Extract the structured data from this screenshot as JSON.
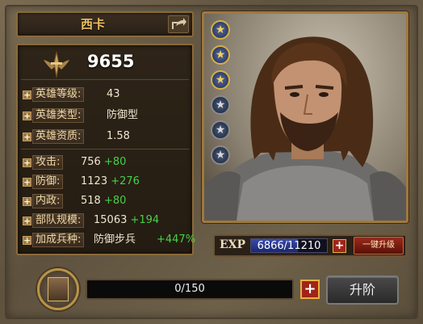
{
  "hero": {
    "name": "西卡",
    "power": "9655"
  },
  "stats": {
    "level": {
      "label": "英雄等级:",
      "value": "43"
    },
    "type": {
      "label": "英雄类型:",
      "value": "防御型"
    },
    "aptitude": {
      "label": "英雄资质:",
      "value": "1.58"
    },
    "attack": {
      "label": "攻击:",
      "value": "756",
      "bonus": "+80"
    },
    "defense": {
      "label": "防御:",
      "value": "1123",
      "bonus": "+276"
    },
    "politics": {
      "label": "内政:",
      "value": "518",
      "bonus": "+80"
    },
    "troops": {
      "label": "部队规模:",
      "value": "15063",
      "bonus": "+194"
    },
    "bonus_unit": {
      "label": "加成兵种:",
      "value": "防御步兵",
      "bonus": "+447%"
    }
  },
  "stars": {
    "filled": 3,
    "total": 6,
    "icon": "star-icon"
  },
  "exp": {
    "label": "EXP",
    "text": "6866/11210",
    "fraction": 0.6125,
    "upgrade_label": "一键升级"
  },
  "advance": {
    "progress_text": "0/150",
    "fraction": 0,
    "button_label": "升阶"
  },
  "colors": {
    "accent": "#f0c060",
    "bonus": "#48d048",
    "frame": "#8a6a3a"
  }
}
